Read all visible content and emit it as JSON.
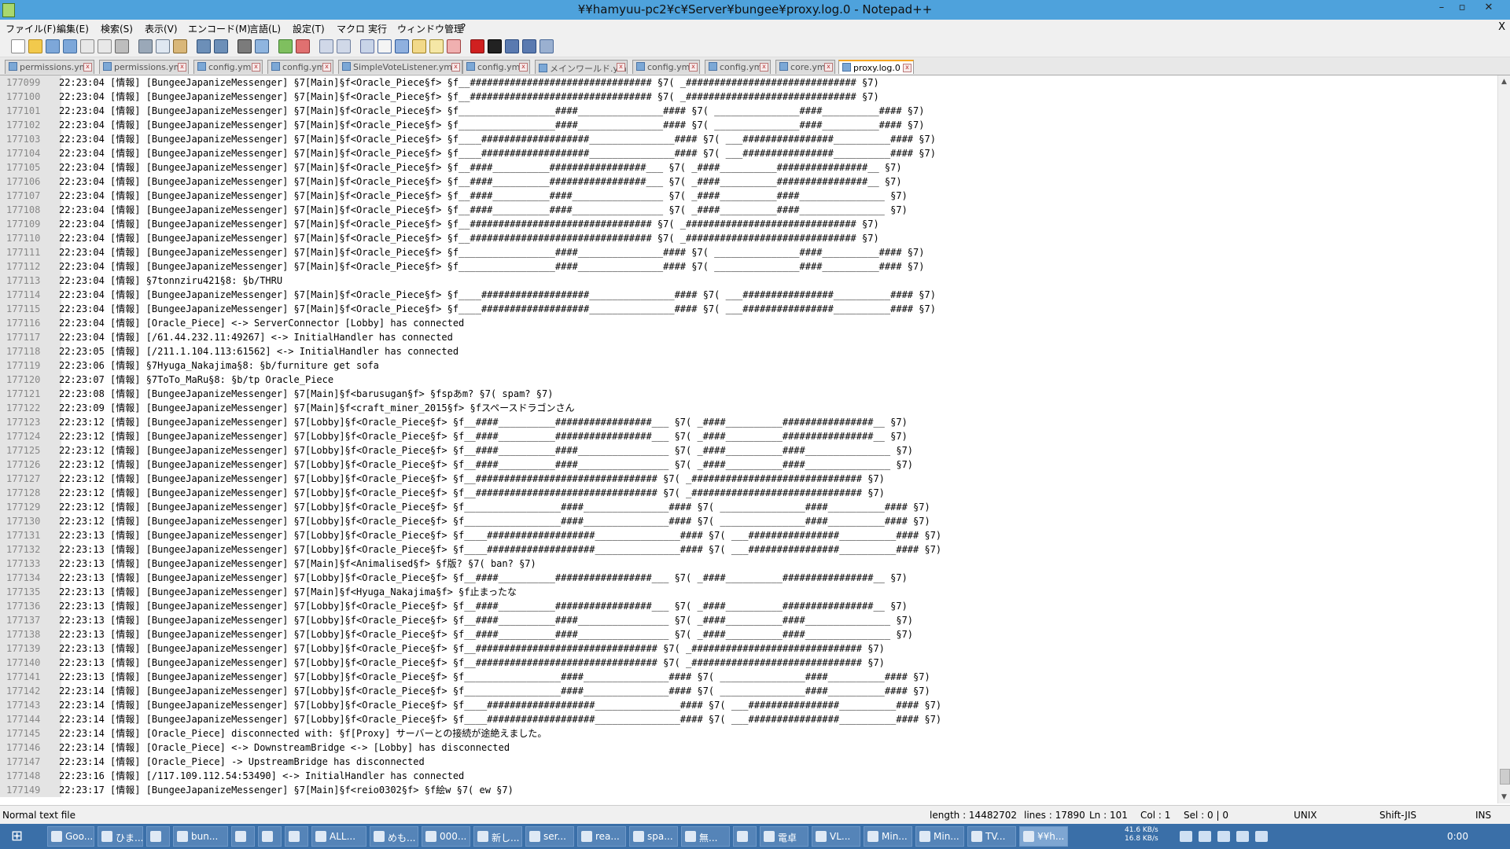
{
  "window": {
    "title": "¥¥hamyuu-pc2¥c¥Server¥bungee¥proxy.log.0 - Notepad++",
    "min": "–",
    "max": "▫",
    "close": "✕"
  },
  "menu": {
    "items": [
      "ファイル(F)",
      "編集(E)",
      "検索(S)",
      "表示(V)",
      "エンコード(M)",
      "言語(L)",
      "設定(T)",
      "マクロ",
      "実行",
      "ウィンドウ管理",
      "?"
    ],
    "close": "X"
  },
  "toolbar": {
    "icons": [
      {
        "name": "new-file-icon",
        "color": "#ffffff",
        "border": "#888888"
      },
      {
        "name": "open-file-icon",
        "color": "#f2c94c",
        "border": "#b38a1e"
      },
      {
        "name": "save-icon",
        "color": "#7da7d9",
        "border": "#3f6b9e"
      },
      {
        "name": "save-all-icon",
        "color": "#7da7d9",
        "border": "#3f6b9e"
      },
      {
        "name": "close-file-icon",
        "color": "#e8e8e8",
        "border": "#888888"
      },
      {
        "name": "close-all-icon",
        "color": "#e8e8e8",
        "border": "#888888"
      },
      {
        "name": "print-icon",
        "color": "#bdbdbd",
        "border": "#666666"
      },
      {
        "name": "cut-icon",
        "color": "#9aa8b8",
        "border": "#5a6878"
      },
      {
        "name": "copy-icon",
        "color": "#dfe7f1",
        "border": "#6a7a8e"
      },
      {
        "name": "paste-icon",
        "color": "#d9b779",
        "border": "#8a6a2f"
      },
      {
        "name": "undo-icon",
        "color": "#6c8fb8",
        "border": "#2f4f77"
      },
      {
        "name": "redo-icon",
        "color": "#6c8fb8",
        "border": "#2f4f77"
      },
      {
        "name": "find-icon",
        "color": "#7b7b7b",
        "border": "#333333"
      },
      {
        "name": "replace-icon",
        "color": "#8fb5df",
        "border": "#3c5f8a"
      },
      {
        "name": "zoom-in-icon",
        "color": "#7fbf5f",
        "border": "#3f7f2f"
      },
      {
        "name": "zoom-out-icon",
        "color": "#e07070",
        "border": "#903030"
      },
      {
        "name": "sync-vertical-icon",
        "color": "#d0d8e8",
        "border": "#7080a0"
      },
      {
        "name": "sync-horizontal-icon",
        "color": "#d0d8e8",
        "border": "#7080a0"
      },
      {
        "name": "word-wrap-icon",
        "color": "#c8d4e8",
        "border": "#6070a0"
      },
      {
        "name": "show-all-chars-icon",
        "color": "#f4f4f4",
        "border": "#4a6aa0"
      },
      {
        "name": "indent-guide-icon",
        "color": "#8fb0df",
        "border": "#2f5a9a"
      },
      {
        "name": "user-lang-icon",
        "color": "#f2d98a",
        "border": "#a08020"
      },
      {
        "name": "doc-map-icon",
        "color": "#f5e7a6",
        "border": "#a08a30"
      },
      {
        "name": "function-list-icon",
        "color": "#f0b0b0",
        "border": "#a04040"
      },
      {
        "name": "record-macro-icon",
        "color": "#d02020",
        "border": "#801010"
      },
      {
        "name": "stop-macro-icon",
        "color": "#222222",
        "border": "#000000"
      },
      {
        "name": "play-macro-icon",
        "color": "#5a7ab0",
        "border": "#2a4a80"
      },
      {
        "name": "play-multiple-icon",
        "color": "#5a7ab0",
        "border": "#2a4a80"
      },
      {
        "name": "save-macro-icon",
        "color": "#9ab0d0",
        "border": "#4a6a9a"
      }
    ]
  },
  "tabs": [
    "permissions.yml",
    "permissions.yml",
    "config.yml",
    "config.yml",
    "SimpleVoteListener.yml",
    "config.yml",
    "メインワールド.yml",
    "config.yml",
    "config.yml",
    "core.yml",
    "proxy.log.0"
  ],
  "active_tab": "proxy.log.0",
  "lines": [
    {
      "n": "177099",
      "t": "22:23:04 [情報] [BungeeJapanizeMessenger] §7[Main]§f<Oracle_Piece§f> §f__################################ §7( _############################## §7)"
    },
    {
      "n": "177100",
      "t": "22:23:04 [情報] [BungeeJapanizeMessenger] §7[Main]§f<Oracle_Piece§f> §f__################################ §7( _############################## §7)"
    },
    {
      "n": "177101",
      "t": "22:23:04 [情報] [BungeeJapanizeMessenger] §7[Main]§f<Oracle_Piece§f> §f_________________####_______________#### §7( _______________####__________#### §7)"
    },
    {
      "n": "177102",
      "t": "22:23:04 [情報] [BungeeJapanizeMessenger] §7[Main]§f<Oracle_Piece§f> §f_________________####_______________#### §7( _______________####__________#### §7)"
    },
    {
      "n": "177103",
      "t": "22:23:04 [情報] [BungeeJapanizeMessenger] §7[Main]§f<Oracle_Piece§f> §f____###################_______________#### §7( ___################__________#### §7)"
    },
    {
      "n": "177104",
      "t": "22:23:04 [情報] [BungeeJapanizeMessenger] §7[Main]§f<Oracle_Piece§f> §f____###################_______________#### §7( ___################__________#### §7)"
    },
    {
      "n": "177105",
      "t": "22:23:04 [情報] [BungeeJapanizeMessenger] §7[Main]§f<Oracle_Piece§f> §f__####__________#################___ §7( _####__________################__ §7)"
    },
    {
      "n": "177106",
      "t": "22:23:04 [情報] [BungeeJapanizeMessenger] §7[Main]§f<Oracle_Piece§f> §f__####__________#################___ §7( _####__________################__ §7)"
    },
    {
      "n": "177107",
      "t": "22:23:04 [情報] [BungeeJapanizeMessenger] §7[Main]§f<Oracle_Piece§f> §f__####__________####________________ §7( _####__________####_______________ §7)"
    },
    {
      "n": "177108",
      "t": "22:23:04 [情報] [BungeeJapanizeMessenger] §7[Main]§f<Oracle_Piece§f> §f__####__________####________________ §7( _####__________####_______________ §7)"
    },
    {
      "n": "177109",
      "t": "22:23:04 [情報] [BungeeJapanizeMessenger] §7[Main]§f<Oracle_Piece§f> §f__################################ §7( _############################## §7)"
    },
    {
      "n": "177110",
      "t": "22:23:04 [情報] [BungeeJapanizeMessenger] §7[Main]§f<Oracle_Piece§f> §f__################################ §7( _############################## §7)"
    },
    {
      "n": "177111",
      "t": "22:23:04 [情報] [BungeeJapanizeMessenger] §7[Main]§f<Oracle_Piece§f> §f_________________####_______________#### §7( _______________####__________#### §7)"
    },
    {
      "n": "177112",
      "t": "22:23:04 [情報] [BungeeJapanizeMessenger] §7[Main]§f<Oracle_Piece§f> §f_________________####_______________#### §7( _______________####__________#### §7)"
    },
    {
      "n": "177113",
      "t": "22:23:04 [情報] §7tonnziru421§8: §b/THRU"
    },
    {
      "n": "177114",
      "t": "22:23:04 [情報] [BungeeJapanizeMessenger] §7[Main]§f<Oracle_Piece§f> §f____###################_______________#### §7( ___################__________#### §7)"
    },
    {
      "n": "177115",
      "t": "22:23:04 [情報] [BungeeJapanizeMessenger] §7[Main]§f<Oracle_Piece§f> §f____###################_______________#### §7( ___################__________#### §7)"
    },
    {
      "n": "177116",
      "t": "22:23:04 [情報] [Oracle_Piece] <-> ServerConnector [Lobby] has connected"
    },
    {
      "n": "177117",
      "t": "22:23:04 [情報] [/61.44.232.11:49267] <-> InitialHandler has connected"
    },
    {
      "n": "177118",
      "t": "22:23:05 [情報] [/211.1.104.113:61562] <-> InitialHandler has connected"
    },
    {
      "n": "177119",
      "t": "22:23:06 [情報] §7Hyuga_Nakajima§8: §b/furniture get sofa"
    },
    {
      "n": "177120",
      "t": "22:23:07 [情報] §7ToTo_MaRu§8: §b/tp Oracle_Piece"
    },
    {
      "n": "177121",
      "t": "22:23:08 [情報] [BungeeJapanizeMessenger] §7[Main]§f<barusugan§f> §fspあm? §7( spam? §7)"
    },
    {
      "n": "177122",
      "t": "22:23:09 [情報] [BungeeJapanizeMessenger] §7[Main]§f<craft_miner_2015§f> §fスペースドラゴンさん"
    },
    {
      "n": "177123",
      "t": "22:23:12 [情報] [BungeeJapanizeMessenger] §7[Lobby]§f<Oracle_Piece§f> §f__####__________#################___ §7( _####__________################__ §7)"
    },
    {
      "n": "177124",
      "t": "22:23:12 [情報] [BungeeJapanizeMessenger] §7[Lobby]§f<Oracle_Piece§f> §f__####__________#################___ §7( _####__________################__ §7)"
    },
    {
      "n": "177125",
      "t": "22:23:12 [情報] [BungeeJapanizeMessenger] §7[Lobby]§f<Oracle_Piece§f> §f__####__________####________________ §7( _####__________####_______________ §7)"
    },
    {
      "n": "177126",
      "t": "22:23:12 [情報] [BungeeJapanizeMessenger] §7[Lobby]§f<Oracle_Piece§f> §f__####__________####________________ §7( _####__________####_______________ §7)"
    },
    {
      "n": "177127",
      "t": "22:23:12 [情報] [BungeeJapanizeMessenger] §7[Lobby]§f<Oracle_Piece§f> §f__################################ §7( _############################## §7)"
    },
    {
      "n": "177128",
      "t": "22:23:12 [情報] [BungeeJapanizeMessenger] §7[Lobby]§f<Oracle_Piece§f> §f__################################ §7( _############################## §7)"
    },
    {
      "n": "177129",
      "t": "22:23:12 [情報] [BungeeJapanizeMessenger] §7[Lobby]§f<Oracle_Piece§f> §f_________________####_______________#### §7( _______________####__________#### §7)"
    },
    {
      "n": "177130",
      "t": "22:23:12 [情報] [BungeeJapanizeMessenger] §7[Lobby]§f<Oracle_Piece§f> §f_________________####_______________#### §7( _______________####__________#### §7)"
    },
    {
      "n": "177131",
      "t": "22:23:13 [情報] [BungeeJapanizeMessenger] §7[Lobby]§f<Oracle_Piece§f> §f____###################_______________#### §7( ___################__________#### §7)"
    },
    {
      "n": "177132",
      "t": "22:23:13 [情報] [BungeeJapanizeMessenger] §7[Lobby]§f<Oracle_Piece§f> §f____###################_______________#### §7( ___################__________#### §7)"
    },
    {
      "n": "177133",
      "t": "22:23:13 [情報] [BungeeJapanizeMessenger] §7[Main]§f<Animalised§f> §f版? §7( ban? §7)"
    },
    {
      "n": "177134",
      "t": "22:23:13 [情報] [BungeeJapanizeMessenger] §7[Lobby]§f<Oracle_Piece§f> §f__####__________#################___ §7( _####__________################__ §7)"
    },
    {
      "n": "177135",
      "t": "22:23:13 [情報] [BungeeJapanizeMessenger] §7[Main]§f<Hyuga_Nakajima§f> §f止まったな"
    },
    {
      "n": "177136",
      "t": "22:23:13 [情報] [BungeeJapanizeMessenger] §7[Lobby]§f<Oracle_Piece§f> §f__####__________#################___ §7( _####__________################__ §7)"
    },
    {
      "n": "177137",
      "t": "22:23:13 [情報] [BungeeJapanizeMessenger] §7[Lobby]§f<Oracle_Piece§f> §f__####__________####________________ §7( _####__________####_______________ §7)"
    },
    {
      "n": "177138",
      "t": "22:23:13 [情報] [BungeeJapanizeMessenger] §7[Lobby]§f<Oracle_Piece§f> §f__####__________####________________ §7( _####__________####_______________ §7)"
    },
    {
      "n": "177139",
      "t": "22:23:13 [情報] [BungeeJapanizeMessenger] §7[Lobby]§f<Oracle_Piece§f> §f__################################ §7( _############################## §7)"
    },
    {
      "n": "177140",
      "t": "22:23:13 [情報] [BungeeJapanizeMessenger] §7[Lobby]§f<Oracle_Piece§f> §f__################################ §7( _############################## §7)"
    },
    {
      "n": "177141",
      "t": "22:23:13 [情報] [BungeeJapanizeMessenger] §7[Lobby]§f<Oracle_Piece§f> §f_________________####_______________#### §7( _______________####__________#### §7)"
    },
    {
      "n": "177142",
      "t": "22:23:14 [情報] [BungeeJapanizeMessenger] §7[Lobby]§f<Oracle_Piece§f> §f_________________####_______________#### §7( _______________####__________#### §7)"
    },
    {
      "n": "177143",
      "t": "22:23:14 [情報] [BungeeJapanizeMessenger] §7[Lobby]§f<Oracle_Piece§f> §f____###################_______________#### §7( ___################__________#### §7)"
    },
    {
      "n": "177144",
      "t": "22:23:14 [情報] [BungeeJapanizeMessenger] §7[Lobby]§f<Oracle_Piece§f> §f____###################_______________#### §7( ___################__________#### §7)"
    },
    {
      "n": "177145",
      "t": "22:23:14 [情報] [Oracle_Piece] disconnected with: §f[Proxy] サーバーとの接続が途絶えました。"
    },
    {
      "n": "177146",
      "t": "22:23:14 [情報] [Oracle_Piece] <-> DownstreamBridge <-> [Lobby] has disconnected"
    },
    {
      "n": "177147",
      "t": "22:23:14 [情報] [Oracle_Piece] -> UpstreamBridge has disconnected"
    },
    {
      "n": "177148",
      "t": "22:23:16 [情報] [/117.109.112.54:53490] <-> InitialHandler has connected"
    },
    {
      "n": "177149",
      "t": "22:23:17 [情報] [BungeeJapanizeMessenger] §7[Main]§f<reio0302§f> §f絵w §7( ew §7)"
    }
  ],
  "status": {
    "file_type": "Normal text file",
    "length": "length : 14482702",
    "lines": "lines : 17890",
    "ln": "Ln : 101",
    "col": "Col : 1",
    "sel": "Sel : 0 | 0",
    "eol": "UNIX",
    "encoding": "Shift-JIS",
    "mode": "INS"
  },
  "taskbar": {
    "items": [
      "Goo...",
      "ひま...",
      "",
      "bun...",
      "",
      "",
      "",
      "ALL...",
      "めも...",
      "000...",
      "新し...",
      "ser...",
      "rea...",
      "spa...",
      "無...",
      "",
      "電卓",
      "VL...",
      "Min...",
      "Min...",
      "TV...",
      "¥¥h..."
    ],
    "net_up": "41.6 KB/s",
    "net_down": "16.8 KB/s",
    "clock": "0:00"
  }
}
